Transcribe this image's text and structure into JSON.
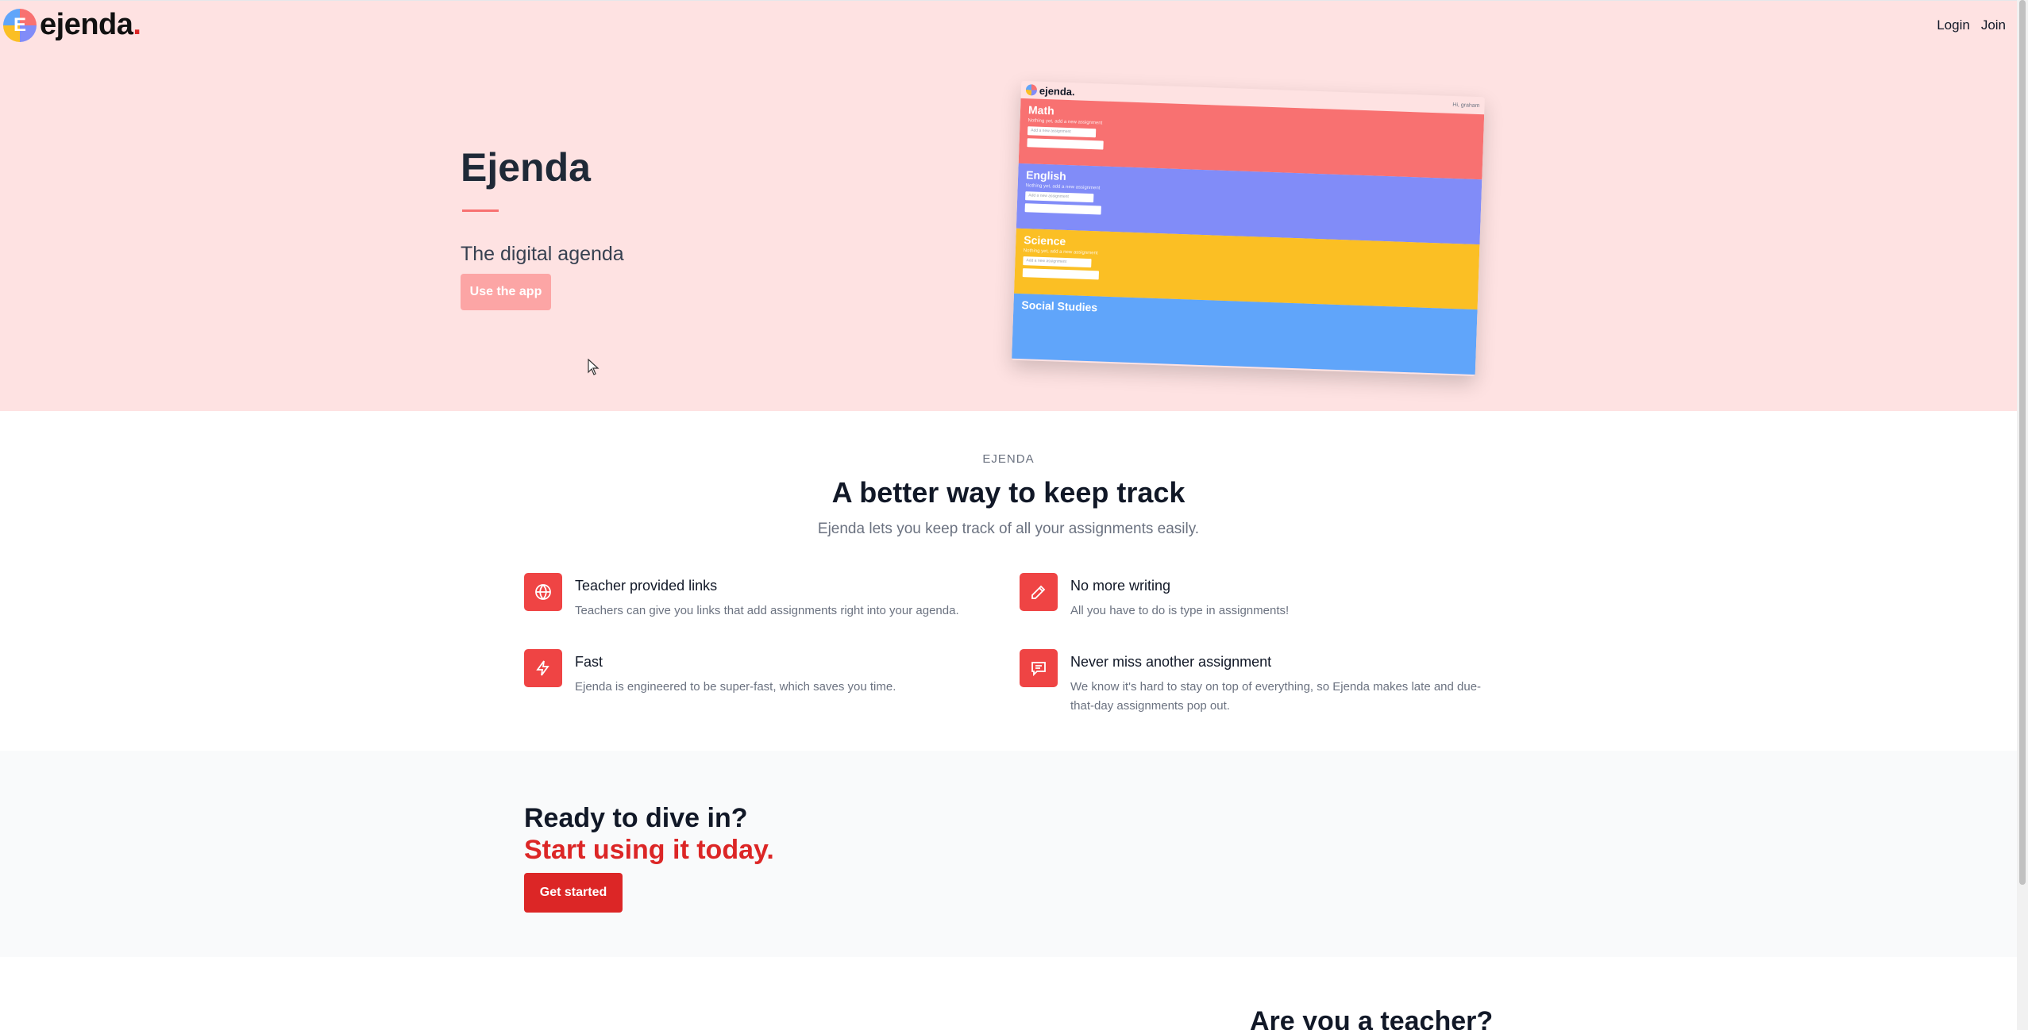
{
  "nav": {
    "brand": "ejenda",
    "brand_dot": ".",
    "logo_letter": "E",
    "login": "Login",
    "join": "Join"
  },
  "hero": {
    "title": "Ejenda",
    "subtitle": "The digital agenda",
    "button": "Use the app",
    "preview": {
      "brand": "ejenda.",
      "user": "Hi, graham",
      "subjects": [
        {
          "name": "Math",
          "color": "#f87171",
          "note": "Nothing yet, add a new assignment",
          "input": "Add a new assignment"
        },
        {
          "name": "English",
          "color": "#818cf8",
          "note": "Nothing yet, add a new assignment",
          "input": "Add a new assignment"
        },
        {
          "name": "Science",
          "color": "#fbbf24",
          "note": "Nothing yet, add a new assignment",
          "input": "Add a new assignment"
        },
        {
          "name": "Social Studies",
          "color": "#60a5fa",
          "note": "",
          "input": ""
        }
      ]
    }
  },
  "features": {
    "eyebrow": "EJENDA",
    "title": "A better way to keep track",
    "subtitle": "Ejenda lets you keep track of all your assignments easily.",
    "items": [
      {
        "icon": "globe-icon",
        "name": "Teacher provided links",
        "desc": "Teachers can give you links that add assignments right into your agenda."
      },
      {
        "icon": "pencil-icon",
        "name": "No more writing",
        "desc": "All you have to do is type in assignments!"
      },
      {
        "icon": "lightning-icon",
        "name": "Fast",
        "desc": "Ejenda is engineered to be super-fast, which saves you time."
      },
      {
        "icon": "chat-icon",
        "name": "Never miss another assignment",
        "desc": "We know it's hard to stay on top of everything, so Ejenda makes late and due-that-day assignments pop out."
      }
    ]
  },
  "cta": {
    "line1": "Ready to dive in?",
    "line2": "Start using it today.",
    "button": "Get started"
  },
  "teacher": {
    "title": "Are you a teacher?"
  },
  "colors": {
    "hero_bg": "#fee2e2",
    "accent": "#ef4444",
    "accent_dark": "#dc2626"
  }
}
